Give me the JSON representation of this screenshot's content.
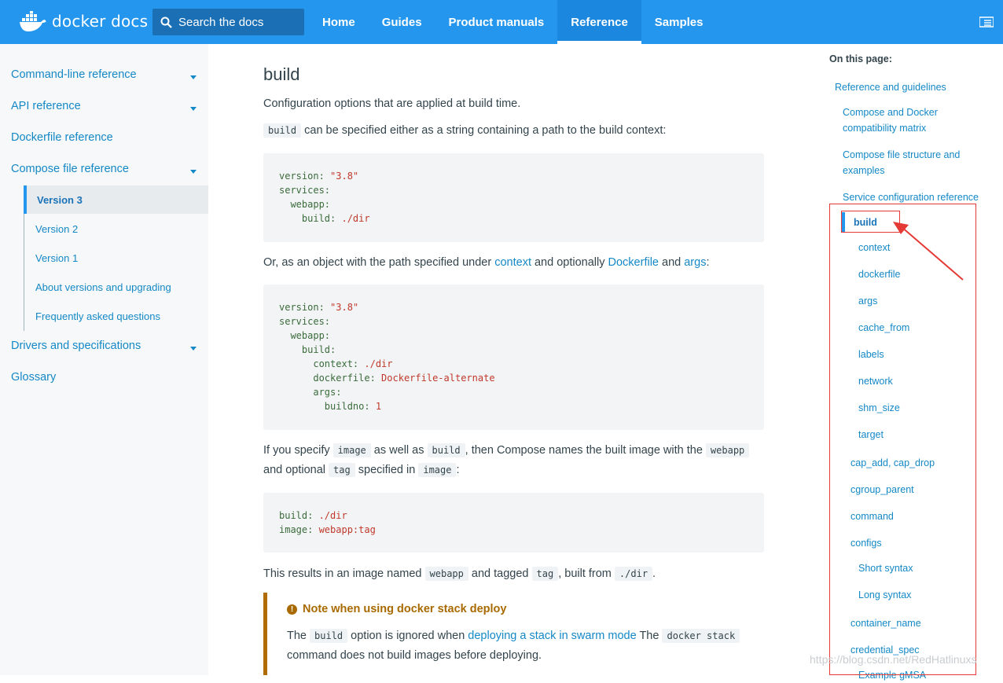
{
  "header": {
    "logo_text": "docker docs",
    "search_placeholder": "Search the docs",
    "nav": [
      {
        "label": "Home"
      },
      {
        "label": "Guides"
      },
      {
        "label": "Product manuals"
      },
      {
        "label": "Reference",
        "active": true
      },
      {
        "label": "Samples"
      }
    ],
    "brand_color": "#2496ed"
  },
  "sidebar": {
    "items": [
      {
        "label": "Command-line reference",
        "expandable": true
      },
      {
        "label": "API reference",
        "expandable": true
      },
      {
        "label": "Dockerfile reference",
        "expandable": false
      },
      {
        "label": "Compose file reference",
        "expandable": true
      },
      {
        "label": "Drivers and specifications",
        "expandable": true
      },
      {
        "label": "Glossary",
        "expandable": false
      }
    ],
    "compose_sub": [
      {
        "label": "Version 3",
        "active": true
      },
      {
        "label": "Version 2"
      },
      {
        "label": "Version 1"
      },
      {
        "label": "About versions and upgrading"
      },
      {
        "label": "Frequently asked questions"
      }
    ]
  },
  "main": {
    "title": "build",
    "intro": "Configuration options that are applied at build time.",
    "p1_code": "build",
    "p1_text": " can be specified either as a string containing a path to the build context:",
    "code1": [
      {
        "k": "version",
        "v": "\"3.8\""
      },
      {
        "k": "services",
        "v": ""
      },
      {
        "k": "  webapp",
        "v": ""
      },
      {
        "k": "    build",
        "v": "./dir"
      }
    ],
    "p2_a": "Or, as an object with the path specified under ",
    "p2_link1": "context",
    "p2_b": " and optionally ",
    "p2_link2": "Dockerfile",
    "p2_c": " and ",
    "p2_link3": "args",
    "p2_d": ":",
    "code2": [
      {
        "k": "version",
        "v": "\"3.8\""
      },
      {
        "k": "services",
        "v": ""
      },
      {
        "k": "  webapp",
        "v": ""
      },
      {
        "k": "    build",
        "v": ""
      },
      {
        "k": "      context",
        "v": "./dir"
      },
      {
        "k": "      dockerfile",
        "v": "Dockerfile-alternate"
      },
      {
        "k": "      args",
        "v": ""
      },
      {
        "k": "        buildno",
        "v": "1"
      }
    ],
    "p3_a": "If you specify ",
    "p3_c1": "image",
    "p3_b": " as well as ",
    "p3_c2": "build",
    "p3_c": ", then Compose names the built image with the ",
    "p3_c3": "webapp",
    "p3_d": "and optional ",
    "p3_c4": "tag",
    "p3_e": " specified in ",
    "p3_c5": "image",
    "p3_f": ":",
    "code3": [
      {
        "k": "build",
        "v": "./dir"
      },
      {
        "k": "image",
        "v": "webapp:tag"
      }
    ],
    "p4_a": "This results in an image named ",
    "p4_c1": "webapp",
    "p4_b": " and tagged ",
    "p4_c2": "tag",
    "p4_c": ", built from ",
    "p4_c3": "./dir",
    "p4_d": ".",
    "note_title": "Note when using docker stack deploy",
    "note_a": "The ",
    "note_c1": "build",
    "note_b": " option is ignored when ",
    "note_link": "deploying a stack in swarm mode",
    "note_c": " The ",
    "note_c2": "docker stack",
    "note_d": "command does not build images before deploying."
  },
  "toc": {
    "heading": "On this page:",
    "items": [
      {
        "label": "Reference and guidelines",
        "level": 0
      },
      {
        "label": "Compose and Docker compatibility matrix",
        "level": 1
      },
      {
        "label": "Compose file structure and examples",
        "level": 1
      },
      {
        "label": "Service configuration reference",
        "level": 1
      },
      {
        "label": "build",
        "level": 2,
        "active": true
      },
      {
        "label": "context",
        "level": 3
      },
      {
        "label": "dockerfile",
        "level": 3
      },
      {
        "label": "args",
        "level": 3
      },
      {
        "label": "cache_from",
        "level": 3
      },
      {
        "label": "labels",
        "level": 3
      },
      {
        "label": "network",
        "level": 3
      },
      {
        "label": "shm_size",
        "level": 3
      },
      {
        "label": "target",
        "level": 3
      },
      {
        "label": "cap_add, cap_drop",
        "level": 2
      },
      {
        "label": "cgroup_parent",
        "level": 2
      },
      {
        "label": "command",
        "level": 2
      },
      {
        "label": "configs",
        "level": 2
      },
      {
        "label": "Short syntax",
        "level": 3
      },
      {
        "label": "Long syntax",
        "level": 3
      },
      {
        "label": "container_name",
        "level": 2
      },
      {
        "label": "credential_spec",
        "level": 2
      },
      {
        "label": "Example gMSA",
        "level": 3
      }
    ]
  },
  "watermark": "https://blog.csdn.net/RedHatlinuxs"
}
